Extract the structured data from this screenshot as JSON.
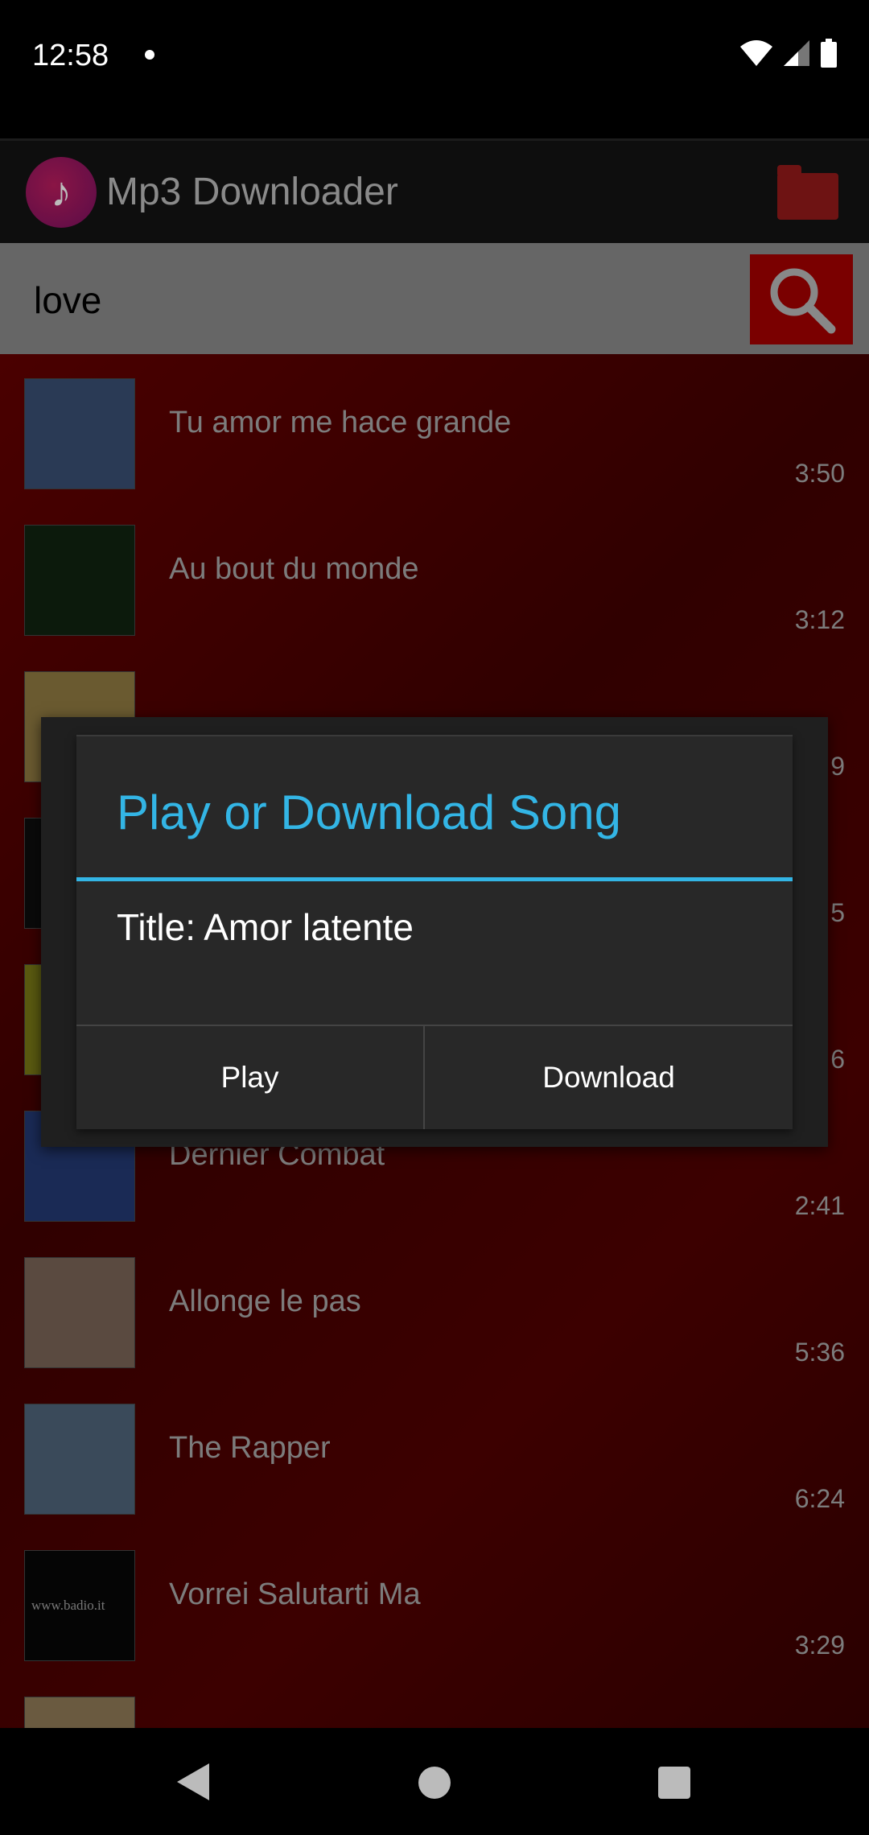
{
  "status_bar": {
    "time": "12:58"
  },
  "app": {
    "title": "Mp3 Downloader",
    "icon": "music-note-download-icon",
    "folder_icon": "folder-icon"
  },
  "search": {
    "value": "love",
    "button_icon": "search-icon"
  },
  "songs": [
    {
      "title": "Tu amor me hace grande",
      "duration": "3:50",
      "thumb": "#2a3a55"
    },
    {
      "title": "Au bout du monde",
      "duration": "3:12",
      "thumb": "#0c1a0c"
    },
    {
      "title": "",
      "duration": "9",
      "thumb": "#6a5a30"
    },
    {
      "title": "",
      "duration": "5",
      "thumb": "#0a0a0a"
    },
    {
      "title": "",
      "duration": "6",
      "thumb": "#5a5a10"
    },
    {
      "title": "Dernier Combat",
      "duration": "2:41",
      "thumb": "#1a2a55"
    },
    {
      "title": "Allonge le pas",
      "duration": "5:36",
      "thumb": "#5a4a40"
    },
    {
      "title": "The Rapper",
      "duration": "6:24",
      "thumb": "#3a4a5a"
    },
    {
      "title": "Vorrei Salutarti Ma",
      "duration": "3:29",
      "thumb": "#050505",
      "thumb_text": "www.badio.it"
    },
    {
      "title": "",
      "duration": "",
      "thumb": "#6a5a40"
    }
  ],
  "dialog": {
    "title": "Play or Download Song",
    "body": "Title: Amor latente",
    "play_label": "Play",
    "download_label": "Download",
    "accent": "#33b5e5"
  },
  "nav": {
    "back": "back-icon",
    "home": "home-icon",
    "recents": "recents-icon"
  }
}
